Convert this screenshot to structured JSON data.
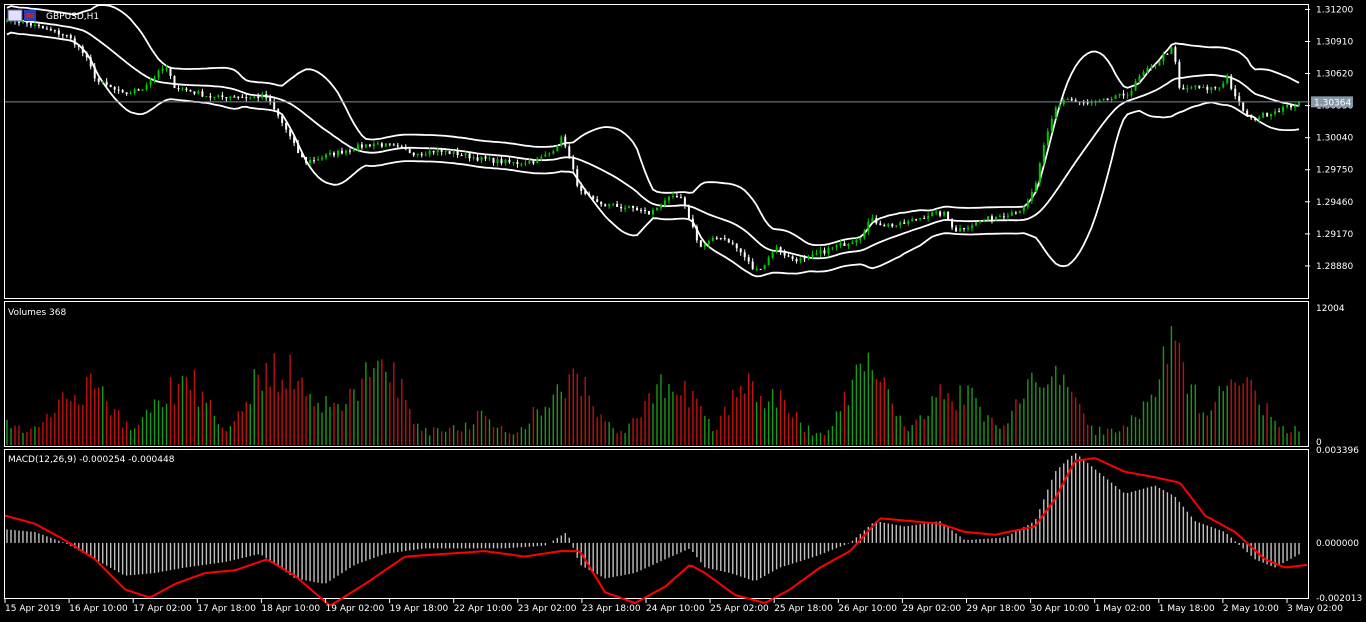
{
  "window": {
    "symbol_label": "GBPUSD,H1",
    "icon": "chart-window-icon"
  },
  "colors": {
    "background": "#000000",
    "frame": "#ffffff",
    "bull_candle": "#00c800",
    "bear_candle": "#ffffff",
    "bands": "#ffffff",
    "volume_up": "#1a9a1a",
    "volume_down": "#c01010",
    "macd_hist": "#c0c0c0",
    "macd_signal": "#ff0000",
    "price_line": "#7a8aa0"
  },
  "chart_data": [
    {
      "type": "candlestick",
      "pane": "price",
      "title": "GBPUSD,H1",
      "symbol": "GBPUSD",
      "timeframe": "H1",
      "indicator": "Bollinger Bands",
      "y_ticks": [
        "1.31200",
        "1.30910",
        "1.30620",
        "1.30330",
        "1.30040",
        "1.29750",
        "1.29460",
        "1.29170",
        "1.28880"
      ],
      "ylim": [
        1.2859,
        1.3124
      ],
      "current_price": "1.30364",
      "current_price_value": 1.30364,
      "close_path": [
        [
          0,
          1.3112
        ],
        [
          20,
          1.3108
        ],
        [
          40,
          1.3102
        ],
        [
          60,
          1.3097
        ],
        [
          70,
          1.309
        ],
        [
          80,
          1.3078
        ],
        [
          92,
          1.3055
        ],
        [
          104,
          1.305
        ],
        [
          118,
          1.3043
        ],
        [
          136,
          1.3048
        ],
        [
          148,
          1.3058
        ],
        [
          160,
          1.3068
        ],
        [
          170,
          1.305
        ],
        [
          190,
          1.3045
        ],
        [
          210,
          1.304
        ],
        [
          230,
          1.3042
        ],
        [
          245,
          1.304
        ],
        [
          260,
          1.3042
        ],
        [
          270,
          1.3028
        ],
        [
          282,
          1.301
        ],
        [
          292,
          1.2992
        ],
        [
          300,
          1.2982
        ],
        [
          312,
          1.2985
        ],
        [
          330,
          1.299
        ],
        [
          350,
          1.2995
        ],
        [
          370,
          1.2999
        ],
        [
          390,
          1.2995
        ],
        [
          410,
          1.299
        ],
        [
          430,
          1.2992
        ],
        [
          450,
          1.299
        ],
        [
          470,
          1.2986
        ],
        [
          490,
          1.2983
        ],
        [
          510,
          1.2981
        ],
        [
          530,
          1.2983
        ],
        [
          545,
          1.299
        ],
        [
          558,
          1.3005
        ],
        [
          566,
          1.298
        ],
        [
          575,
          1.2955
        ],
        [
          590,
          1.2945
        ],
        [
          610,
          1.2942
        ],
        [
          630,
          1.294
        ],
        [
          645,
          1.2935
        ],
        [
          660,
          1.2948
        ],
        [
          675,
          1.295
        ],
        [
          685,
          1.293
        ],
        [
          695,
          1.2905
        ],
        [
          705,
          1.291
        ],
        [
          715,
          1.2915
        ],
        [
          725,
          1.291
        ],
        [
          738,
          1.2898
        ],
        [
          750,
          1.2883
        ],
        [
          760,
          1.289
        ],
        [
          770,
          1.2905
        ],
        [
          785,
          1.2895
        ],
        [
          800,
          1.2893
        ],
        [
          815,
          1.29
        ],
        [
          830,
          1.2905
        ],
        [
          845,
          1.291
        ],
        [
          855,
          1.2915
        ],
        [
          865,
          1.293
        ],
        [
          880,
          1.2925
        ],
        [
          895,
          1.2925
        ],
        [
          910,
          1.293
        ],
        [
          925,
          1.2935
        ],
        [
          940,
          1.2935
        ],
        [
          950,
          1.292
        ],
        [
          965,
          1.2925
        ],
        [
          980,
          1.293
        ],
        [
          1000,
          1.2935
        ],
        [
          1020,
          1.294
        ],
        [
          1030,
          1.296
        ],
        [
          1040,
          1.3
        ],
        [
          1050,
          1.303
        ],
        [
          1060,
          1.304
        ],
        [
          1075,
          1.3035
        ],
        [
          1090,
          1.3035
        ],
        [
          1110,
          1.304
        ],
        [
          1125,
          1.3045
        ],
        [
          1135,
          1.306
        ],
        [
          1150,
          1.307
        ],
        [
          1160,
          1.308
        ],
        [
          1168,
          1.3085
        ],
        [
          1175,
          1.3045
        ],
        [
          1185,
          1.305
        ],
        [
          1200,
          1.3048
        ],
        [
          1215,
          1.305
        ],
        [
          1222,
          1.306
        ],
        [
          1230,
          1.304
        ],
        [
          1245,
          1.302
        ],
        [
          1260,
          1.3025
        ],
        [
          1275,
          1.303
        ],
        [
          1290,
          1.3034
        ],
        [
          1300,
          1.3036
        ]
      ]
    },
    {
      "type": "bar",
      "pane": "volume",
      "title": "Volumes 368",
      "indicator": "Volumes",
      "last_value": 368,
      "y_ticks": [
        "12004",
        "0"
      ],
      "ylim": [
        0,
        12004
      ],
      "peaks": [
        [
          5,
          2600
        ],
        [
          65,
          6000
        ],
        [
          90,
          7400
        ],
        [
          165,
          6900
        ],
        [
          185,
          7300
        ],
        [
          262,
          9600
        ],
        [
          285,
          8100
        ],
        [
          330,
          6200
        ],
        [
          360,
          7700
        ],
        [
          380,
          9500
        ],
        [
          475,
          3300
        ],
        [
          548,
          6000
        ],
        [
          573,
          7700
        ],
        [
          655,
          7200
        ],
        [
          675,
          6900
        ],
        [
          742,
          7100
        ],
        [
          768,
          6200
        ],
        [
          862,
          10100
        ],
        [
          935,
          5700
        ],
        [
          960,
          6200
        ],
        [
          1030,
          7200
        ],
        [
          1052,
          7600
        ],
        [
          1140,
          4500
        ],
        [
          1168,
          11600
        ],
        [
          1222,
          6900
        ],
        [
          1240,
          7500
        ],
        [
          1300,
          2000
        ]
      ]
    },
    {
      "type": "bar",
      "pane": "macd",
      "title": "MACD(12,26,9) -0.000254 -0.000448",
      "indicator": "MACD(12,26,9)",
      "macd_value": "-0.000254",
      "signal_value": "-0.000448",
      "y_ticks": [
        "0.003396",
        "0.000000",
        "-0.002013"
      ],
      "ylim": [
        -0.002013,
        0.003396
      ],
      "histogram": [
        [
          0,
          0.0005
        ],
        [
          30,
          0.0004
        ],
        [
          60,
          0.0
        ],
        [
          90,
          -0.0006
        ],
        [
          120,
          -0.0012
        ],
        [
          150,
          -0.0011
        ],
        [
          180,
          -0.0009
        ],
        [
          220,
          -0.0007
        ],
        [
          255,
          -0.0004
        ],
        [
          290,
          -0.0013
        ],
        [
          320,
          -0.0015
        ],
        [
          350,
          -0.0008
        ],
        [
          380,
          -0.0004
        ],
        [
          420,
          -0.0002
        ],
        [
          460,
          -0.0002
        ],
        [
          500,
          -0.0002
        ],
        [
          540,
          -0.0001
        ],
        [
          562,
          0.0004
        ],
        [
          575,
          -0.0008
        ],
        [
          600,
          -0.0013
        ],
        [
          630,
          -0.0011
        ],
        [
          660,
          -0.0006
        ],
        [
          685,
          -0.0002
        ],
        [
          700,
          -0.0009
        ],
        [
          725,
          -0.0011
        ],
        [
          750,
          -0.0014
        ],
        [
          775,
          -0.0009
        ],
        [
          810,
          -0.0005
        ],
        [
          845,
          0.0
        ],
        [
          870,
          0.0008
        ],
        [
          900,
          0.0006
        ],
        [
          935,
          0.0008
        ],
        [
          960,
          0.0001
        ],
        [
          1000,
          0.0002
        ],
        [
          1030,
          0.0008
        ],
        [
          1050,
          0.0026
        ],
        [
          1070,
          0.0033
        ],
        [
          1090,
          0.0027
        ],
        [
          1120,
          0.0018
        ],
        [
          1150,
          0.0021
        ],
        [
          1170,
          0.0017
        ],
        [
          1190,
          0.0008
        ],
        [
          1220,
          0.0004
        ],
        [
          1250,
          -0.0006
        ],
        [
          1270,
          -0.0009
        ],
        [
          1300,
          -0.0003
        ]
      ],
      "signal": [
        [
          0,
          0.001
        ],
        [
          30,
          0.0007
        ],
        [
          60,
          0.0001
        ],
        [
          90,
          -0.0006
        ],
        [
          120,
          -0.0017
        ],
        [
          145,
          -0.002
        ],
        [
          170,
          -0.0015
        ],
        [
          200,
          -0.0011
        ],
        [
          230,
          -0.001
        ],
        [
          262,
          -0.0006
        ],
        [
          290,
          -0.0012
        ],
        [
          325,
          -0.0023
        ],
        [
          360,
          -0.0015
        ],
        [
          400,
          -0.0005
        ],
        [
          440,
          -0.0004
        ],
        [
          480,
          -0.0003
        ],
        [
          520,
          -0.0005
        ],
        [
          555,
          -0.0003
        ],
        [
          575,
          -0.0003
        ],
        [
          600,
          -0.0018
        ],
        [
          630,
          -0.0022
        ],
        [
          660,
          -0.0016
        ],
        [
          685,
          -0.0008
        ],
        [
          700,
          -0.0011
        ],
        [
          730,
          -0.0019
        ],
        [
          760,
          -0.0022
        ],
        [
          785,
          -0.0017
        ],
        [
          815,
          -0.0009
        ],
        [
          845,
          -0.0003
        ],
        [
          875,
          0.0009
        ],
        [
          905,
          0.0008
        ],
        [
          935,
          0.0007
        ],
        [
          960,
          0.0004
        ],
        [
          990,
          0.0003
        ],
        [
          1030,
          0.0006
        ],
        [
          1050,
          0.0016
        ],
        [
          1070,
          0.003
        ],
        [
          1090,
          0.0031
        ],
        [
          1120,
          0.0026
        ],
        [
          1150,
          0.0024
        ],
        [
          1175,
          0.0022
        ],
        [
          1200,
          0.001
        ],
        [
          1230,
          0.0004
        ],
        [
          1260,
          -0.0006
        ],
        [
          1280,
          -0.0009
        ],
        [
          1303,
          -0.0008
        ]
      ]
    }
  ],
  "x_axis": {
    "labels": [
      "15 Apr 2019",
      "16 Apr 10:00",
      "17 Apr 02:00",
      "17 Apr 18:00",
      "18 Apr 10:00",
      "19 Apr 02:00",
      "19 Apr 18:00",
      "22 Apr 10:00",
      "23 Apr 02:00",
      "23 Apr 18:00",
      "24 Apr 10:00",
      "25 Apr 02:00",
      "25 Apr 18:00",
      "26 Apr 10:00",
      "29 Apr 02:00",
      "29 Apr 18:00",
      "30 Apr 10:00",
      "1 May 02:00",
      "1 May 18:00",
      "2 May 10:00",
      "3 May 02:00"
    ]
  }
}
